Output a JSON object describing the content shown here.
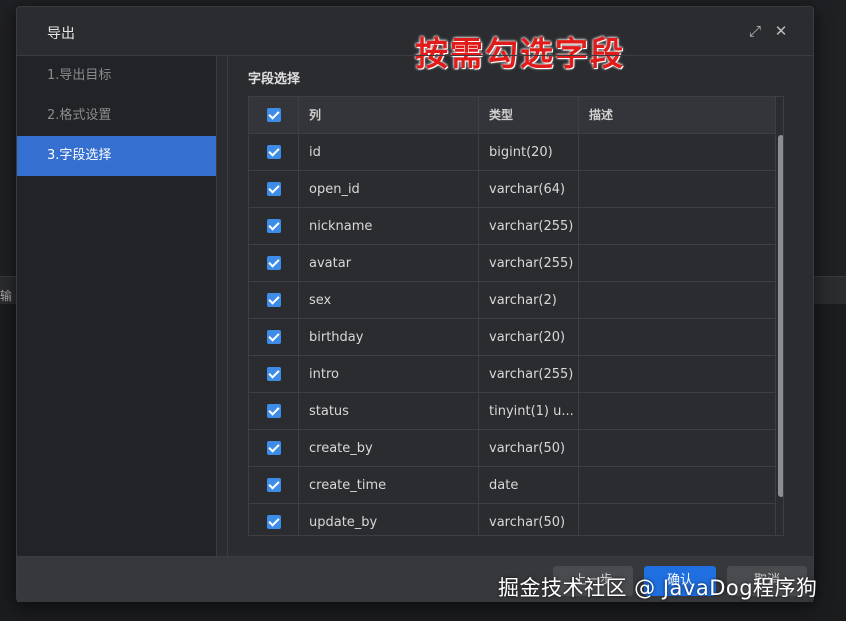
{
  "dialog": {
    "title": "导出",
    "expand_icon": "expand-icon",
    "close_icon": "close-icon"
  },
  "annotation": "按需勾选字段",
  "background": {
    "side_label": "输"
  },
  "steps": [
    {
      "label": "1.导出目标",
      "active": false
    },
    {
      "label": "2.格式设置",
      "active": false
    },
    {
      "label": "3.字段选择",
      "active": true
    }
  ],
  "section_title": "字段选择",
  "table": {
    "headers": {
      "column": "列",
      "type": "类型",
      "description": "描述"
    },
    "rows": [
      {
        "checked": true,
        "column": "id",
        "type": "bigint(20)",
        "description": ""
      },
      {
        "checked": true,
        "column": "open_id",
        "type": "varchar(64)",
        "description": ""
      },
      {
        "checked": true,
        "column": "nickname",
        "type": "varchar(255)",
        "description": ""
      },
      {
        "checked": true,
        "column": "avatar",
        "type": "varchar(255)",
        "description": ""
      },
      {
        "checked": true,
        "column": "sex",
        "type": "varchar(2)",
        "description": ""
      },
      {
        "checked": true,
        "column": "birthday",
        "type": "varchar(20)",
        "description": ""
      },
      {
        "checked": true,
        "column": "intro",
        "type": "varchar(255)",
        "description": ""
      },
      {
        "checked": true,
        "column": "status",
        "type": "tinyint(1) u...",
        "description": ""
      },
      {
        "checked": true,
        "column": "create_by",
        "type": "varchar(50)",
        "description": ""
      },
      {
        "checked": true,
        "column": "create_time",
        "type": "date",
        "description": ""
      },
      {
        "checked": true,
        "column": "update_by",
        "type": "varchar(50)",
        "description": ""
      }
    ]
  },
  "footer": {
    "prev_label": "上一步",
    "ok_label": "确认",
    "cancel_label": "取消"
  },
  "watermark": "掘金技术社区 @ JavaDog程序狗",
  "colors": {
    "accent": "#3570d0",
    "primary_button": "#1f6fe0",
    "checkbox": "#3d8de8",
    "annotation": "#e11a1a"
  }
}
